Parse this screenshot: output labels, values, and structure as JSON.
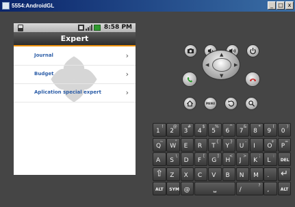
{
  "window": {
    "title": "5554:AndroidGL",
    "minimize": "_",
    "maximize": "□",
    "close": "x"
  },
  "status_bar": {
    "time": "8:58 PM"
  },
  "app": {
    "title": "Expert",
    "menu": [
      {
        "label": "Journal",
        "chevron": "›"
      },
      {
        "label": "Budget",
        "chevron": "›"
      },
      {
        "label": "Aplication special expert",
        "chevron": "›"
      }
    ]
  },
  "hardware_buttons": {
    "camera": "camera-icon",
    "volume_down": "volume-down-icon",
    "volume_up": "volume-up-icon",
    "power": "power-icon",
    "call": "call-icon",
    "end_call": "end-call-icon",
    "home": "home-icon",
    "menu": "MENU",
    "back": "back-icon",
    "search": "search-icon"
  },
  "colors": {
    "accent": "#f0920c",
    "link": "#2d5ea8",
    "call": "#2a9a2a",
    "end_call": "#c62020"
  },
  "keyboard": {
    "rows": [
      [
        {
          "k": "1",
          "a": "!"
        },
        {
          "k": "2",
          "a": "@"
        },
        {
          "k": "3",
          "a": "#"
        },
        {
          "k": "4",
          "a": "$"
        },
        {
          "k": "5",
          "a": "%"
        },
        {
          "k": "6",
          "a": "^"
        },
        {
          "k": "7",
          "a": "&"
        },
        {
          "k": "8",
          "a": "*"
        },
        {
          "k": "9",
          "a": "("
        },
        {
          "k": "0",
          "a": ")"
        }
      ],
      [
        {
          "k": "Q",
          "a": "~"
        },
        {
          "k": "W",
          "a": "\""
        },
        {
          "k": "E",
          "a": ""
        },
        {
          "k": "R",
          "a": ""
        },
        {
          "k": "T",
          "a": "{"
        },
        {
          "k": "Y",
          "a": "}"
        },
        {
          "k": "U",
          "a": "-"
        },
        {
          "k": "I",
          "a": ""
        },
        {
          "k": "O",
          "a": "+"
        },
        {
          "k": "P",
          "a": "="
        }
      ],
      [
        {
          "k": "A",
          "a": ""
        },
        {
          "k": "S",
          "a": "\\"
        },
        {
          "k": "D",
          "a": ""
        },
        {
          "k": "F",
          "a": "["
        },
        {
          "k": "G",
          "a": "]"
        },
        {
          "k": "H",
          "a": "<"
        },
        {
          "k": "J",
          "a": ">"
        },
        {
          "k": "K",
          "a": ";"
        },
        {
          "k": "L",
          "a": ":"
        },
        {
          "k": "DEL",
          "a": ""
        }
      ],
      [
        {
          "k": "⇧",
          "a": ""
        },
        {
          "k": "Z",
          "a": ""
        },
        {
          "k": "X",
          "a": ""
        },
        {
          "k": "C",
          "a": ""
        },
        {
          "k": "V",
          "a": ""
        },
        {
          "k": "B",
          "a": ""
        },
        {
          "k": "N",
          "a": ""
        },
        {
          "k": "M",
          "a": ""
        },
        {
          "k": ".",
          "a": ""
        },
        {
          "k": "↵",
          "a": ""
        }
      ],
      [
        {
          "k": "ALT",
          "a": ""
        },
        {
          "k": "SYM",
          "a": ""
        },
        {
          "k": "@",
          "a": ""
        },
        {
          "k": "SPACE",
          "a": ""
        },
        {
          "k": "/",
          "a": "?"
        },
        {
          "k": ",",
          "a": ""
        },
        {
          "k": "ALT",
          "a": ""
        }
      ]
    ]
  }
}
